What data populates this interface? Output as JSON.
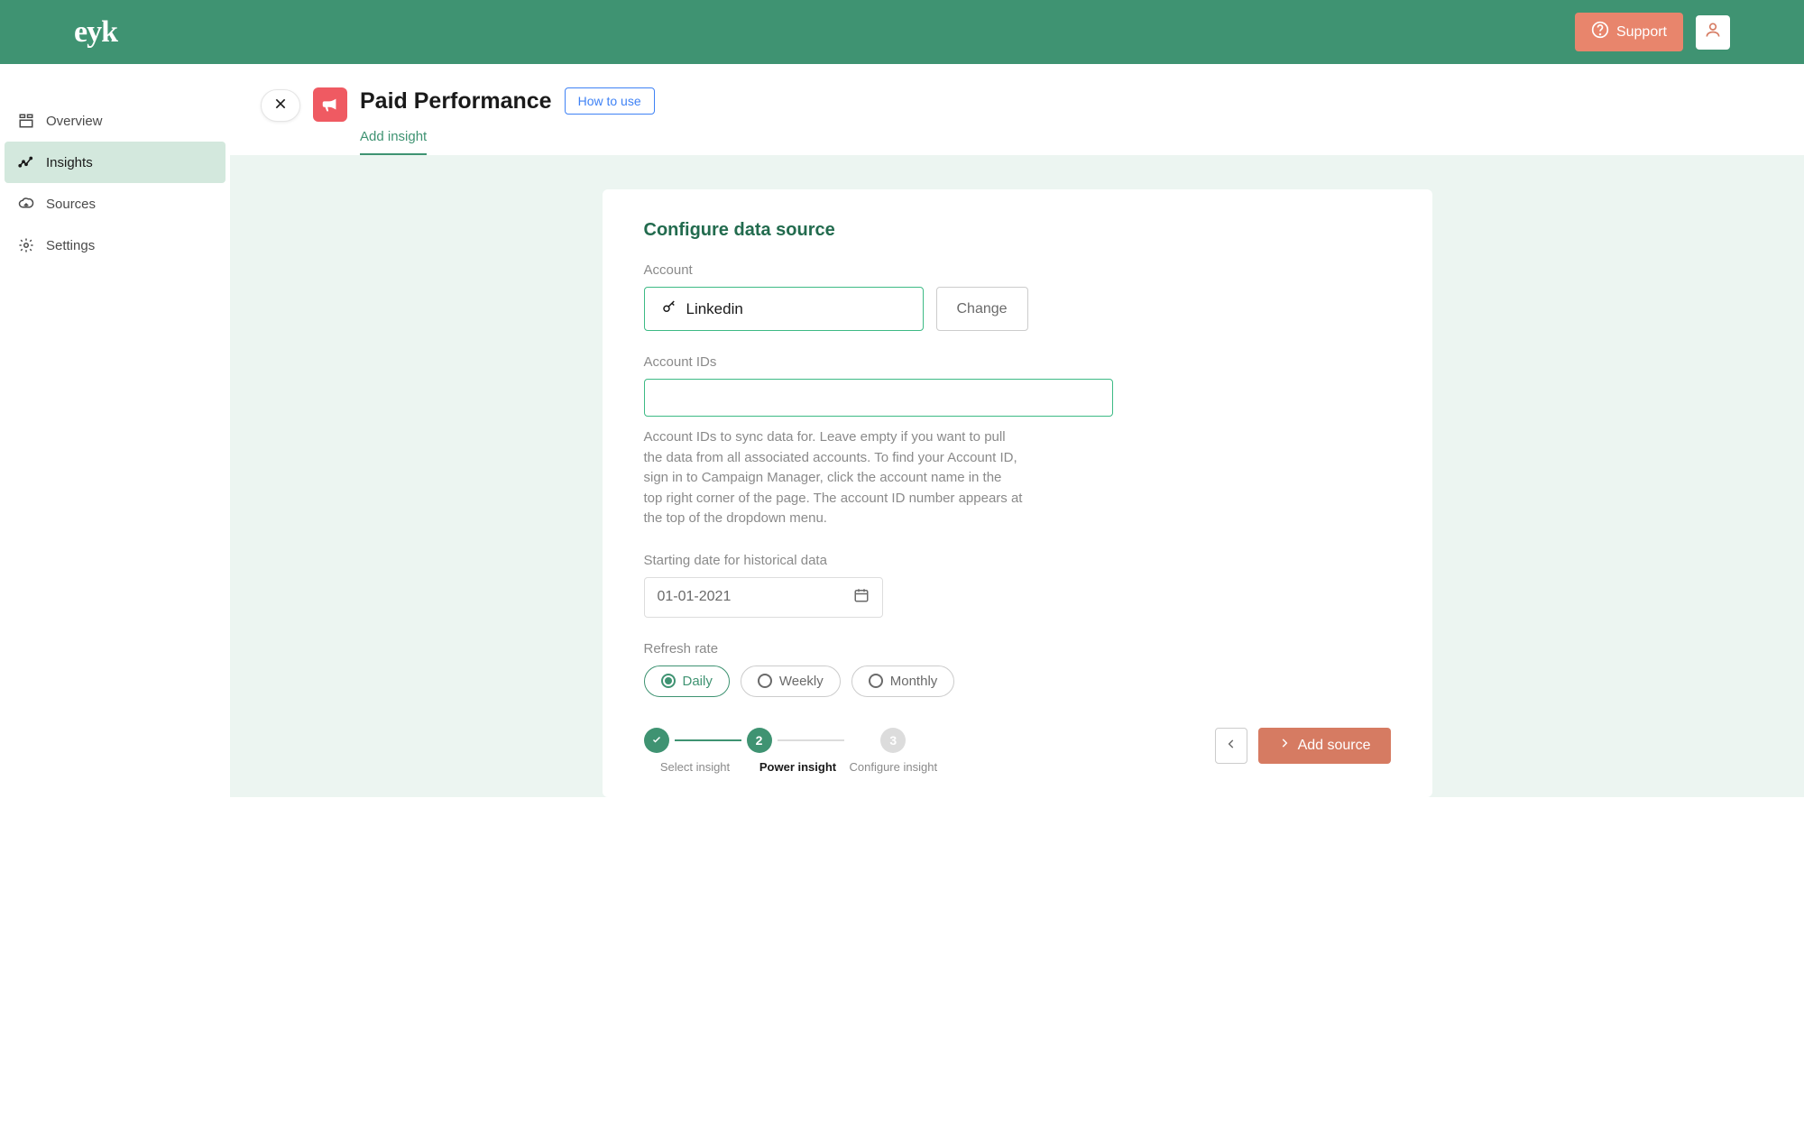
{
  "header": {
    "logo": "eyk",
    "support_label": "Support"
  },
  "sidebar": {
    "items": [
      {
        "label": "Overview"
      },
      {
        "label": "Insights"
      },
      {
        "label": "Sources"
      },
      {
        "label": "Settings"
      }
    ]
  },
  "page": {
    "title": "Paid Performance",
    "how_to_use": "How to use",
    "tab_label": "Add insight"
  },
  "form": {
    "section_title": "Configure data source",
    "account_label": "Account",
    "account_value": "Linkedin",
    "change_label": "Change",
    "account_ids_label": "Account IDs",
    "account_ids_value": "",
    "account_ids_help": "Account IDs to sync data for. Leave empty if you want to pull the data from all associated accounts. To find your Account ID, sign in to Campaign Manager, click the account name in the top right corner of the page. The account ID number appears at the top of the dropdown menu.",
    "start_date_label": "Starting date for historical data",
    "start_date_value": "01-01-2021",
    "refresh_label": "Refresh rate",
    "refresh_options": [
      {
        "label": "Daily"
      },
      {
        "label": "Weekly"
      },
      {
        "label": "Monthly"
      }
    ]
  },
  "stepper": {
    "steps": [
      {
        "label": "Select insight"
      },
      {
        "label": "Power insight",
        "num": "2"
      },
      {
        "label": "Configure insight",
        "num": "3"
      }
    ]
  },
  "actions": {
    "add_source": "Add source"
  }
}
